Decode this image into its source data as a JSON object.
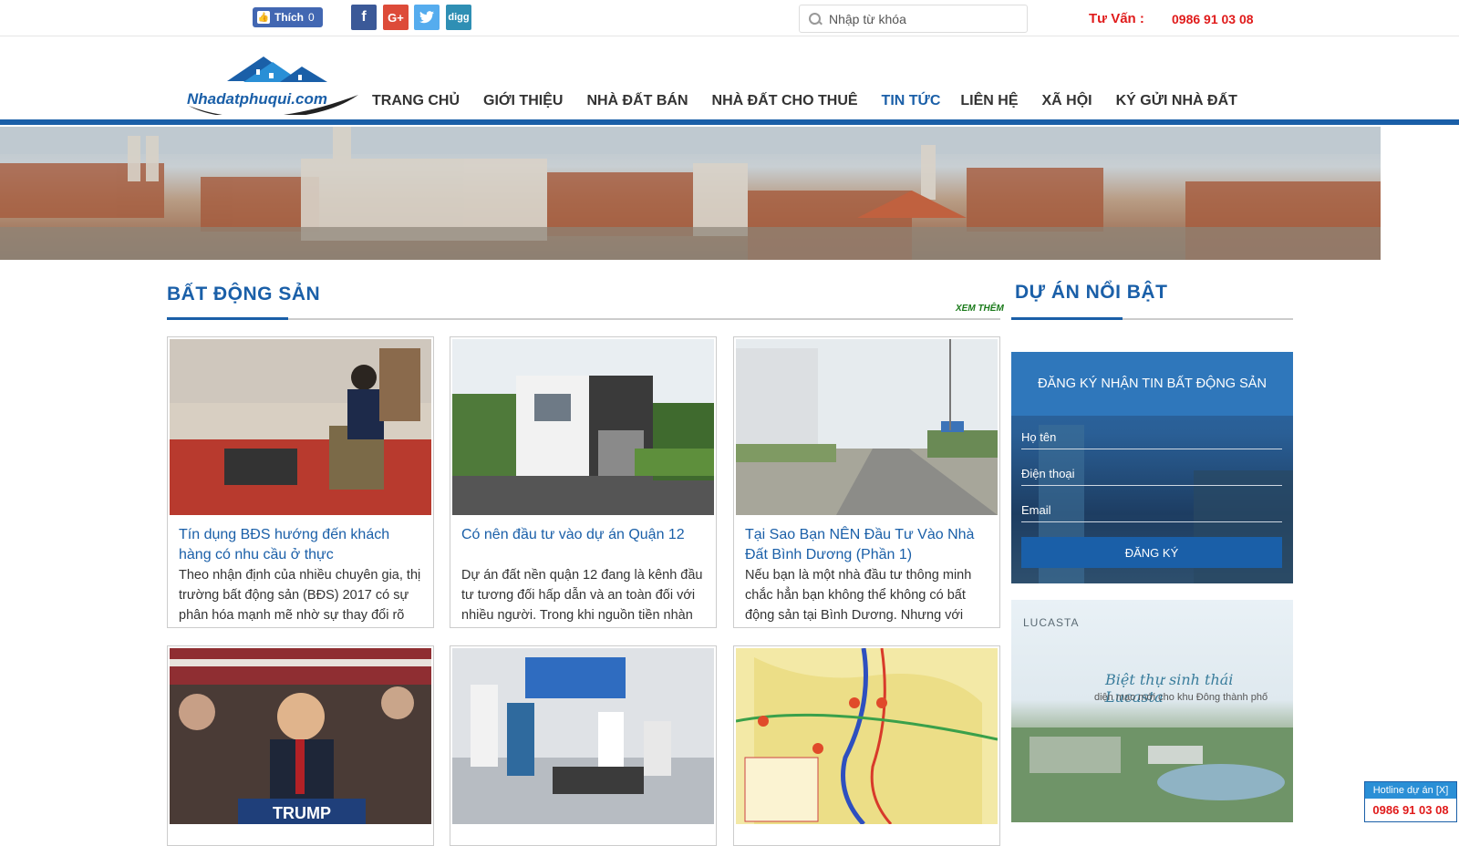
{
  "topbar": {
    "like_label": "Thích",
    "like_count": "0",
    "social": [
      "facebook-icon",
      "google-plus-icon",
      "twitter-icon",
      "digg-icon"
    ],
    "search_placeholder": "Nhập từ khóa",
    "consult_label": "Tư Vấn :",
    "consult_phone": "0986 91 03 08"
  },
  "logo_text": "Nhadatphuqui.com",
  "nav": [
    {
      "label": "TRANG CHỦ",
      "active": false
    },
    {
      "label": "GIỚI THIỆU",
      "active": false
    },
    {
      "label": "NHÀ ĐẤT BÁN",
      "active": false
    },
    {
      "label": "NHÀ ĐẤT CHO THUÊ",
      "active": false
    },
    {
      "label": "TIN TỨC",
      "active": true
    },
    {
      "label": "LIÊN HỆ",
      "active": false
    },
    {
      "label": "XÃ HỘI",
      "active": false
    },
    {
      "label": "KÝ GỬI NHÀ ĐẤT",
      "active": false
    }
  ],
  "main": {
    "section_title": "BẤT ĐỘNG SẢN",
    "more_label": "XEM THÊM",
    "articles": [
      {
        "title": "Tín dụng BĐS hướng đến khách hàng có nhu cầu ở thực",
        "excerpt": "Theo nhận định của nhiều chuyên gia, thị trường bất động sản (BĐS) 2017 có sự phân hóa mạnh mẽ nhờ sự thay đổi rõ"
      },
      {
        "title": "Có nên đầu tư vào dự án Quận 12",
        "excerpt": "Dự án đất nền quận 12 đang là kênh đầu tư tương đối hấp dẫn và an toàn đối với nhiều người. Trong khi nguồn tiền nhàn"
      },
      {
        "title": "Tại Sao Bạn NÊN Đầu Tư Vào Nhà Đất Bình Dương (Phần 1)",
        "excerpt": "Nếu bạn là một nhà đầu tư thông minh chắc hẳn bạn không thể không có bất động sản tại Bình Dương. Nhưng với"
      }
    ],
    "second_row_sign": "TRUMP"
  },
  "sidebar": {
    "section_title": "DỰ ÁN NỔI BẬT",
    "register": {
      "header": "ĐĂNG KÝ NHẬN TIN BẤT ĐỘNG SẢN",
      "fields": [
        "Họ tên",
        "Điện thoại",
        "Email"
      ],
      "button": "ĐĂNG KÝ"
    },
    "ad": {
      "brand": "LUCASTA",
      "headline": "Biệt thự sinh thái Lucasta",
      "subline": "diện mạo mới cho khu Đông thành phố"
    }
  },
  "hotline": {
    "label": "Hotline dự án [X]",
    "phone": "0986 91 03 08"
  },
  "colors": {
    "brand_blue": "#1a5fa8",
    "alert_red": "#e01b1b"
  }
}
